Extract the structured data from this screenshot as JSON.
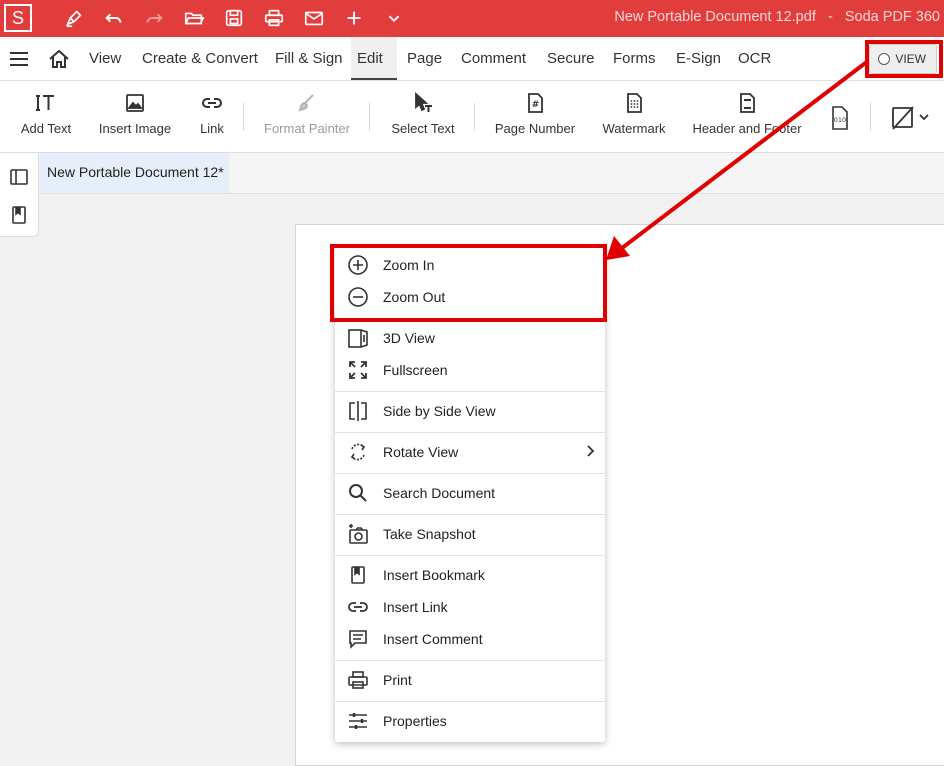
{
  "titlebar": {
    "logo_letter": "S",
    "document_title": "New Portable Document 12.pdf",
    "separator": "-",
    "app_name": "Soda PDF 360",
    "quick_access": [
      {
        "name": "sign-pen-icon"
      },
      {
        "name": "undo-icon"
      },
      {
        "name": "redo-icon"
      },
      {
        "name": "open-folder-icon"
      },
      {
        "name": "save-icon"
      },
      {
        "name": "print-icon"
      },
      {
        "name": "mail-icon"
      },
      {
        "name": "new-plus-icon"
      },
      {
        "name": "chevron-down-icon"
      }
    ]
  },
  "menubar": {
    "items": [
      {
        "label": "View"
      },
      {
        "label": "Create & Convert"
      },
      {
        "label": "Fill & Sign"
      },
      {
        "label": "Edit",
        "active": true
      },
      {
        "label": "Page"
      },
      {
        "label": "Comment"
      },
      {
        "label": "Secure"
      },
      {
        "label": "Forms"
      },
      {
        "label": "E-Sign"
      },
      {
        "label": "OCR"
      }
    ],
    "view_button": "VIEW"
  },
  "ribbon": {
    "tools": [
      {
        "label": "Add Text",
        "icon": "add-text-icon"
      },
      {
        "label": "Insert Image",
        "icon": "image-icon"
      },
      {
        "label": "Link",
        "icon": "link-icon"
      },
      {
        "label": "Format Painter",
        "icon": "brush-icon",
        "disabled": true
      },
      {
        "label": "Select Text",
        "icon": "select-text-cursor-icon"
      },
      {
        "label": "Page Number",
        "icon": "page-number-icon"
      },
      {
        "label": "Watermark",
        "icon": "watermark-icon"
      },
      {
        "label": "Header and Footer",
        "icon": "header-footer-icon"
      }
    ],
    "bates_label": "010"
  },
  "tabs": {
    "doc_tab": "New Portable Document 12*"
  },
  "context_menu": {
    "items": [
      {
        "label": "Zoom In",
        "icon": "zoom-in-icon"
      },
      {
        "label": "Zoom Out",
        "icon": "zoom-out-icon"
      },
      {
        "label": "3D View",
        "icon": "3d-view-icon"
      },
      {
        "label": "Fullscreen",
        "icon": "fullscreen-icon"
      },
      {
        "label": "Side by Side View",
        "icon": "side-by-side-icon"
      },
      {
        "label": "Rotate View",
        "icon": "rotate-icon",
        "submenu": true
      },
      {
        "label": "Search Document",
        "icon": "search-icon"
      },
      {
        "label": "Take Snapshot",
        "icon": "camera-icon"
      },
      {
        "label": "Insert Bookmark",
        "icon": "bookmark-icon"
      },
      {
        "label": "Insert Link",
        "icon": "link-icon"
      },
      {
        "label": "Insert Comment",
        "icon": "comment-icon"
      },
      {
        "label": "Print",
        "icon": "print-icon"
      },
      {
        "label": "Properties",
        "icon": "properties-sliders-icon"
      }
    ]
  },
  "colors": {
    "titlebar": "#e23d3d",
    "highlight": "#e00000",
    "active_tab": "#e6eefa"
  }
}
